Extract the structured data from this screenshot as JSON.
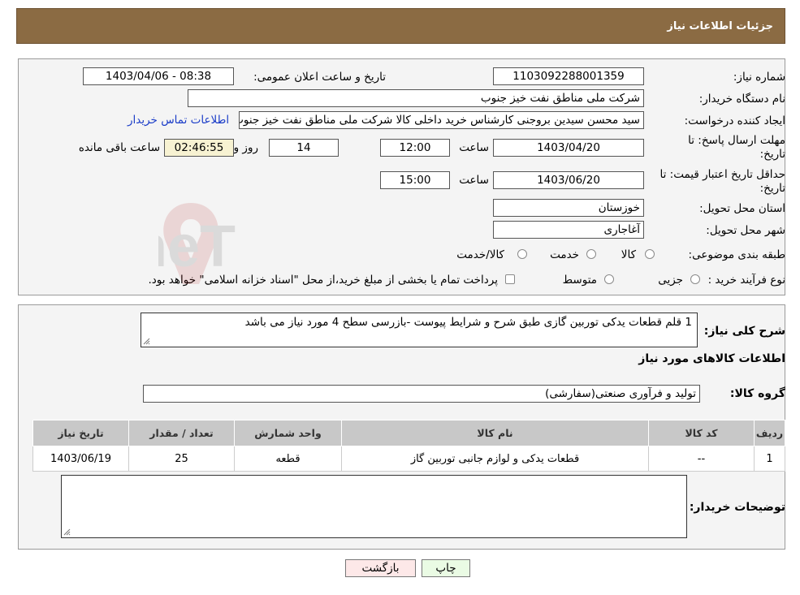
{
  "header": {
    "title": "جزئیات اطلاعات نیاز"
  },
  "form": {
    "need_number_label": "شماره نیاز:",
    "need_number": "1103092288001359",
    "announce_label": "تاریخ و ساعت اعلان عمومی:",
    "announce_value": "1403/04/06 - 08:38",
    "buyer_org_label": "نام دستگاه خریدار:",
    "buyer_org": "شرکت ملی مناطق نفت خیز جنوب",
    "creator_label": "ایجاد کننده درخواست:",
    "creator": "سید محسن  سیدین بروجنی  کارشناس خرید داخلی کالا  شرکت ملی مناطق نفت خیز جنوب",
    "contact_link": "اطلاعات تماس خریدار",
    "deadline_label_1": "مهلت ارسال پاسخ: تا",
    "deadline_label_2": "تاریخ:",
    "deadline_date": "1403/04/20",
    "time_label": "ساعت",
    "deadline_time": "12:00",
    "days_value": "14",
    "days_label": "روز و",
    "remaining_value": "02:46:55",
    "remaining_label": "ساعت باقی مانده",
    "validity_label_1": "حداقل تاریخ اعتبار قیمت: تا",
    "validity_label_2": "تاریخ:",
    "validity_date": "1403/06/20",
    "validity_time_label": "ساعت",
    "validity_time": "15:00",
    "province_label": "استان محل تحویل:",
    "province": "خوزستان",
    "city_label": "شهر محل تحویل:",
    "city": "آغاجاری",
    "category_label": "طبقه بندی موضوعی:",
    "category_options": [
      "کالا",
      "خدمت",
      "کالا/خدمت"
    ],
    "process_label": "نوع فرآیند خرید :",
    "process_options": [
      "جزیی",
      "متوسط"
    ],
    "process_note": "پرداخت تمام یا بخشی از مبلغ خرید،از محل \"اسناد خزانه اسلامی\" خواهد بود."
  },
  "details": {
    "summary_label": "شرح کلی نیاز:",
    "summary": "1 قلم قطعات یدکی توربین گازی طبق شرح و شرایط پیوست -بازرسی سطح 4 مورد نیاز می باشد",
    "goods_info_title": "اطلاعات کالاهای مورد نیاز",
    "goods_group_label": "گروه کالا:",
    "goods_group": "تولید و فرآوری صنعتی(سفارشی)",
    "buyer_notes_label": "توضیحات خریدار:",
    "buyer_notes": ""
  },
  "table": {
    "headers": [
      "ردیف",
      "کد کالا",
      "نام کالا",
      "واحد شمارش",
      "تعداد / مقدار",
      "تاریخ نیاز"
    ],
    "rows": [
      [
        "1",
        "--",
        "قطعات یدکی و لوازم جانبی توربین گاز",
        "قطعه",
        "25",
        "1403/06/19"
      ]
    ]
  },
  "buttons": {
    "print": "چاپ",
    "back": "بازگشت"
  },
  "watermark": "AriaTender.neT",
  "colors": {
    "header_bg": "#8b6b43",
    "link": "#1a3cc8",
    "back_button_bg": "#fde8e8",
    "print_button_bg": "#eafbe4"
  }
}
